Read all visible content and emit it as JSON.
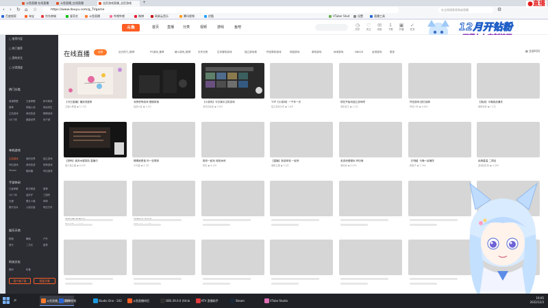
{
  "browser": {
    "tabs": [
      {
        "label": "斗鱼直播 在线直播"
      },
      {
        "label": "斗鱼直播_在线直播"
      },
      {
        "label": "全民游戏直播_全民游戏"
      }
    ],
    "url": "https://www.douyu.com/g_TVgame",
    "search_placeholder": "在全网搜索视频或直播",
    "bookmarks": [
      {
        "label": "百度搜索",
        "color": "#2a65d6"
      },
      {
        "label": "淘宝",
        "color": "#ff5d23"
      },
      {
        "label": "京东商城",
        "color": "#e4393c"
      },
      {
        "label": "爱奇艺",
        "color": "#00be06"
      },
      {
        "label": "斗鱼直播",
        "color": "#ff7a2d"
      },
      {
        "label": "哔哩哔哩",
        "color": "#fb7299"
      },
      {
        "label": "微博",
        "color": "#e6162d"
      },
      {
        "label": "网易云音乐",
        "color": "#c20c0c"
      },
      {
        "label": "腾讯视频",
        "color": "#ff9b1a"
      },
      {
        "label": "优酷",
        "color": "#1ea0ff"
      },
      {
        "label": "VTuber Stud",
        "color": "#6ab04c"
      },
      {
        "label": "设置",
        "color": "#888888"
      },
      {
        "label": "直播工具",
        "color": "#2a65d6"
      }
    ]
  },
  "site": {
    "logo": "斗鱼",
    "nav": [
      "首页",
      "直播",
      "分类",
      "视频",
      "游戏",
      "鱼吧"
    ],
    "header_icons": [
      {
        "icon": "history-icon",
        "label": "历史"
      },
      {
        "icon": "follow-icon",
        "label": "关注"
      },
      {
        "icon": "message-icon",
        "label": "消息"
      },
      {
        "icon": "download-icon",
        "label": "下载"
      },
      {
        "icon": "live-icon",
        "label": "开播"
      },
      {
        "icon": "task-icon",
        "label": "任务"
      }
    ],
    "banner_line1": "12月开钻粉",
    "banner_line2": "可得七七定制挂画",
    "live_badge": "直播"
  },
  "sidebar": {
    "top_items": [
      "推荐内容",
      "热门推荐",
      "我的关注",
      "分类频道"
    ],
    "section1": {
      "title": "热门分类",
      "items": [
        "英雄联盟",
        "王者荣耀",
        "和平精英",
        "原神",
        "穿越火线",
        "绝地求生",
        "主机游戏",
        "单机热游",
        "棋牌游戏",
        "QQ飞车",
        "魔兽世界",
        "地下城"
      ]
    },
    "section2": {
      "title": "单机游戏",
      "items": [
        "主机游戏",
        "我的世界",
        "独立游戏",
        "怀旧游戏",
        "单机热游",
        "恐怖游戏",
        "Steam",
        "模拟器",
        "怀旧游戏"
      ]
    },
    "section3": {
      "title": "手游休闲",
      "items": [
        "王者荣耀",
        "和平精英",
        "原神",
        "QQ飞车",
        "金铲铲",
        "三国杀",
        "光遇",
        "第五人格",
        "球球",
        "蛋仔派对",
        "火影忍者",
        "明日方舟"
      ]
    },
    "section4": {
      "title": "娱乐天地",
      "items": [
        "颜值",
        "舞蹈",
        "户外",
        "音乐",
        "二次元",
        "星秀"
      ]
    },
    "section5": {
      "title": "科技文化",
      "items": [
        "数码",
        "科普"
      ]
    },
    "buttons": [
      "客户端下载",
      "我要开播"
    ]
  },
  "main": {
    "title": "在线直播",
    "filters": [
      "全部",
      "近日热门_推荐",
      "PS游戏_推荐",
      "格斗游戏_推荐",
      "无冬无夜",
      "生存冒险游戏",
      "独立游戏类",
      "怀旧单机游戏",
      "网游游戏",
      "单机游戏",
      "休闲游戏",
      "NBA2K",
      "足球游戏",
      "更多"
    ],
    "view_toggle": "全部时间",
    "cards": [
      {
        "title": "【今日直播】播放进度条",
        "streamer": "主播小黑猫",
        "viewers": "11.5万",
        "kind": "pastel"
      },
      {
        "title": "深夜恐怖游戏 慢慢探索",
        "streamer": "独游大叔",
        "viewers": "3.2万",
        "kind": "dark"
      },
      {
        "title": "【小游戏】今日演示主机游戏",
        "streamer": "游戏实验室",
        "viewers": "5.6万",
        "kind": "ui"
      },
      {
        "title": "TOP【小游戏】一千年一次",
        "streamer": "独立游戏分享",
        "viewers": "1.8万",
        "kind": "blank"
      },
      {
        "title": "现在开始玩独立游戏吧",
        "streamer": "单机老王",
        "viewers": "2.1万",
        "kind": "blank"
      },
      {
        "title": "怀旧游戏 回忆经典",
        "streamer": "怀旧少年",
        "viewers": "9,820",
        "kind": "blank"
      },
      {
        "title": "【挑战】今晚挑战通关",
        "streamer": "硬核玩家",
        "viewers": "1.2万",
        "kind": "blank"
      },
      {
        "title": "【恐怖】废弃木屋探险 直播中",
        "streamer": "胆小鬼主播",
        "viewers": "8,455",
        "kind": "dark2"
      },
      {
        "title": "猜猜我是谁 你一定想到",
        "streamer": "小可爱",
        "viewers": "2.3万",
        "kind": "blank"
      },
      {
        "title": "陪你一起玩 轻松休闲",
        "streamer": "阿花",
        "viewers": "6,120",
        "kind": "blank"
      },
      {
        "title": "【直播】新游体验 一起来",
        "streamer": "萌新主播",
        "viewers": "3.4万",
        "kind": "blank"
      },
      {
        "title": "老游戏慢慢玩 怀旧局",
        "streamer": "老玩家",
        "viewers": "5,530",
        "kind": "blank"
      },
      {
        "title": "【开播】今晚一起通关",
        "streamer": "夜猫子",
        "viewers": "7,760",
        "kind": "blank"
      },
      {
        "title": "经典重温 二周目",
        "streamer": "游戏回忆录",
        "viewers": "4,390",
        "kind": "blank"
      },
      {
        "title": "单机闲聊 随便玩玩",
        "streamer": "随缘主播",
        "viewers": "2,880",
        "kind": "blank"
      },
      {
        "title": "速通练习 冲冲冲",
        "streamer": "速通小王",
        "viewers": "1.1万",
        "kind": "blank"
      }
    ]
  },
  "taskbar": {
    "items": [
      {
        "label": "斗鱼直播_在线直播",
        "color": "#ff7a2d"
      },
      {
        "label": "16:9视频",
        "color": "#2a65d6"
      },
      {
        "label": "Studio One - 202",
        "color": "#1a9be0"
      },
      {
        "label": "斗鱼直播伴侣",
        "color": "#ff5d23"
      },
      {
        "label": "OBS 29.0.0 (64-bi",
        "color": "#303030"
      },
      {
        "label": "KTV 直播助手",
        "color": "#e4393c"
      },
      {
        "label": "Steam",
        "color": "#1b2838"
      },
      {
        "label": "VTube Studio",
        "color": "#e06fb6"
      }
    ],
    "time": "19:05",
    "date": "2022/12/3"
  }
}
